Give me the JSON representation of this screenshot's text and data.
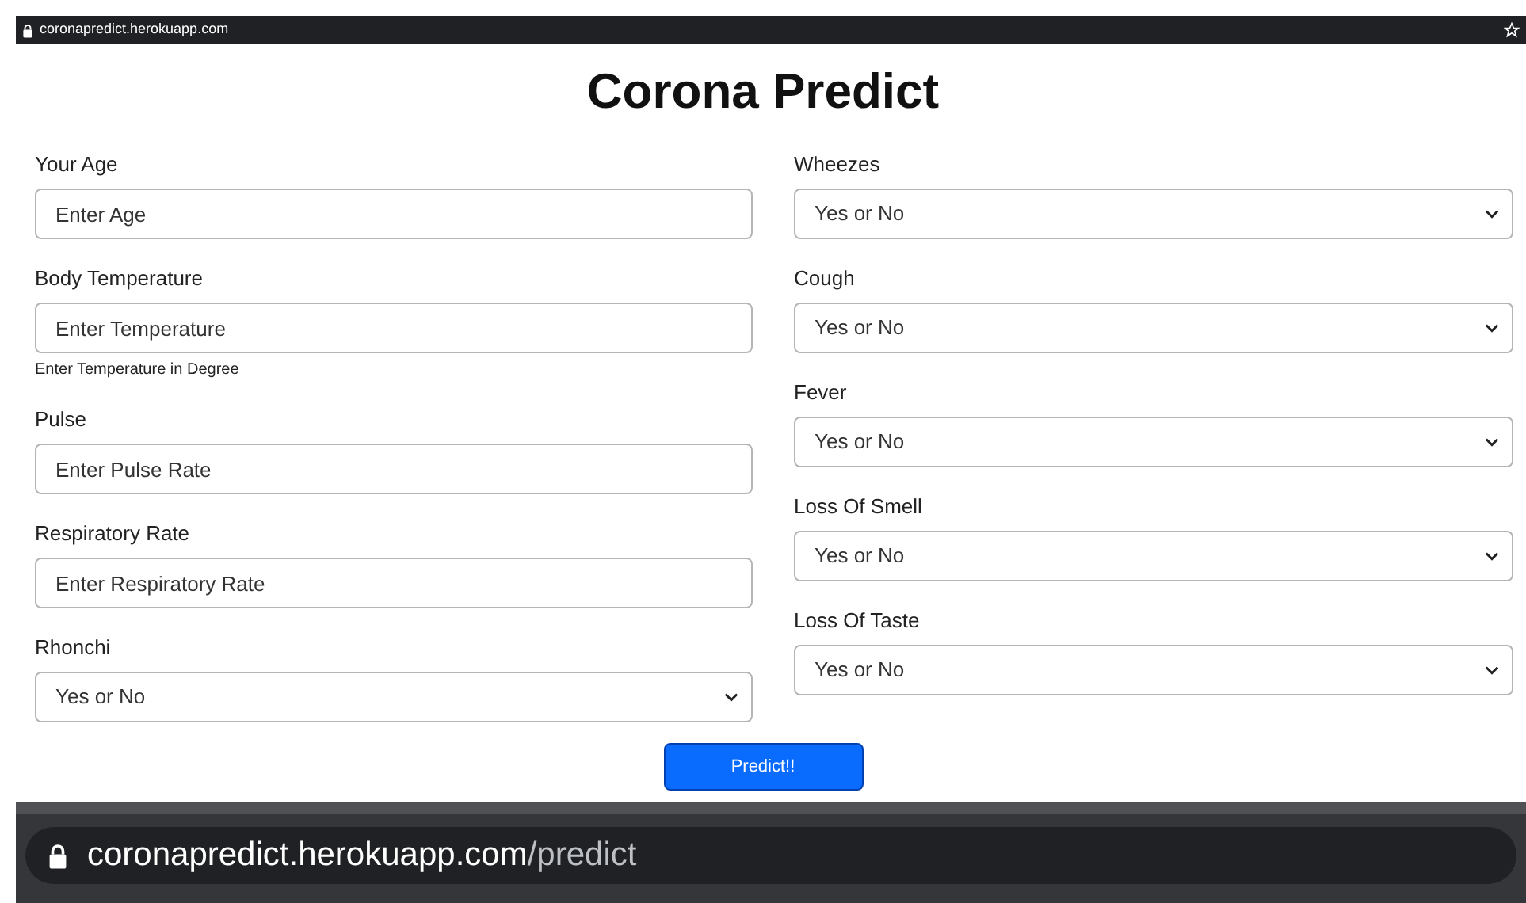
{
  "top_address_bar": {
    "url": "coronapredict.herokuapp.com"
  },
  "title": "Corona Predict",
  "left_fields": [
    {
      "label": "Your Age",
      "kind": "text",
      "placeholder": "Enter Age"
    },
    {
      "label": "Body Temperature",
      "kind": "text",
      "placeholder": "Enter Temperature",
      "help": "Enter Temperature in Degree"
    },
    {
      "label": "Pulse",
      "kind": "text",
      "placeholder": "Enter Pulse Rate"
    },
    {
      "label": "Respiratory Rate",
      "kind": "text",
      "placeholder": "Enter Respiratory Rate"
    },
    {
      "label": "Rhonchi",
      "kind": "select",
      "value": "Yes or No"
    }
  ],
  "right_fields": [
    {
      "label": "Wheezes",
      "kind": "select",
      "value": "Yes or No"
    },
    {
      "label": "Cough",
      "kind": "select",
      "value": "Yes or No"
    },
    {
      "label": "Fever",
      "kind": "select",
      "value": "Yes or No"
    },
    {
      "label": "Loss Of Smell",
      "kind": "select",
      "value": "Yes or No"
    },
    {
      "label": "Loss Of Taste",
      "kind": "select",
      "value": "Yes or No"
    }
  ],
  "submit_button": "Predict!!",
  "bottom_address_bar": {
    "host": "coronapredict.herokuapp.com",
    "path": "/predict"
  }
}
